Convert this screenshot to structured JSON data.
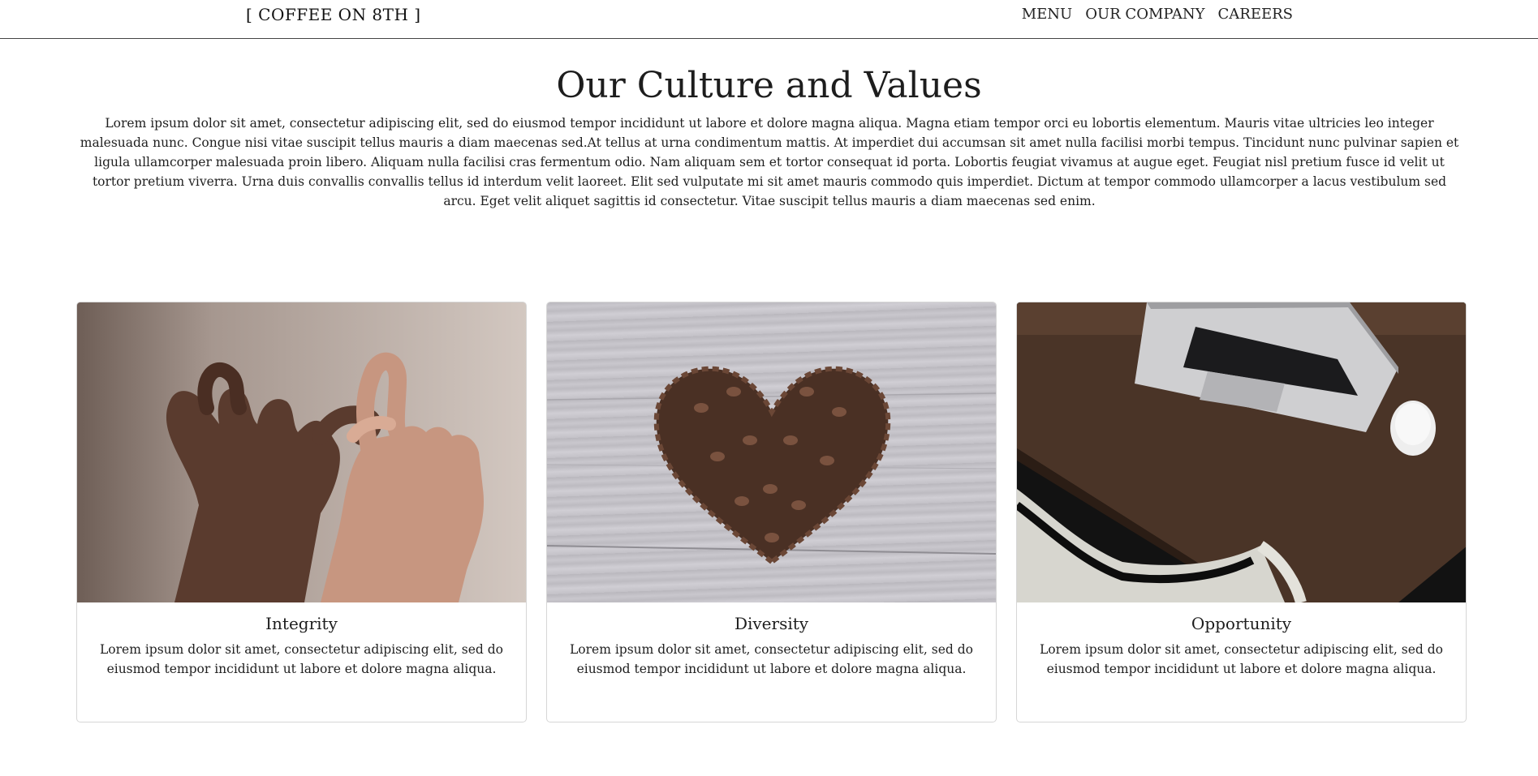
{
  "nav": {
    "brand": "[ COFFEE ON 8TH ]",
    "links": [
      "MENU",
      "OUR COMPANY",
      "CAREERS"
    ]
  },
  "main": {
    "title": "Our Culture and Values",
    "intro": "Lorem ipsum dolor sit amet, consectetur adipiscing elit, sed do eiusmod tempor incididunt ut labore et dolore magna aliqua. Magna etiam tempor orci eu lobortis elementum. Mauris vitae ultricies leo integer malesuada nunc. Congue nisi vitae suscipit tellus mauris a diam maecenas sed.At tellus at urna condimentum mattis. At imperdiet dui accumsan sit amet nulla facilisi morbi tempus. Tincidunt nunc pulvinar sapien et ligula ullamcorper malesuada proin libero. Aliquam nulla facilisi cras fermentum odio. Nam aliquam sem et tortor consequat id porta. Lobortis feugiat vivamus at augue eget. Feugiat nisl pretium fusce id velit ut tortor pretium viverra. Urna duis convallis convallis tellus id interdum velit laoreet. Elit sed vulputate mi sit amet mauris commodo quis imperdiet. Dictum at tempor commodo ullamcorper a lacus vestibulum sed arcu. Eget velit aliquet sagittis id consectetur. Vitae suscipit tellus mauris a diam maecenas sed enim."
  },
  "cards": [
    {
      "title": "Integrity",
      "text": "Lorem ipsum dolor sit amet, consectetur adipiscing elit, sed do eiusmod tempor incididunt ut labore et dolore magna aliqua.",
      "image": "pinky-promise-hands-image"
    },
    {
      "title": "Diversity",
      "text": "Lorem ipsum dolor sit amet, consectetur adipiscing elit, sed do eiusmod tempor incididunt ut labore et dolore magna aliqua.",
      "image": "coffee-bean-heart-image"
    },
    {
      "title": "Opportunity",
      "text": "Lorem ipsum dolor sit amet, consectetur adipiscing elit, sed do eiusmod tempor incididunt ut labore et dolore magna aliqua.",
      "image": "laptop-desk-image"
    }
  ],
  "colors": {
    "text": "#212529",
    "border": "#d6d6d6",
    "nav_border": "#444444"
  }
}
